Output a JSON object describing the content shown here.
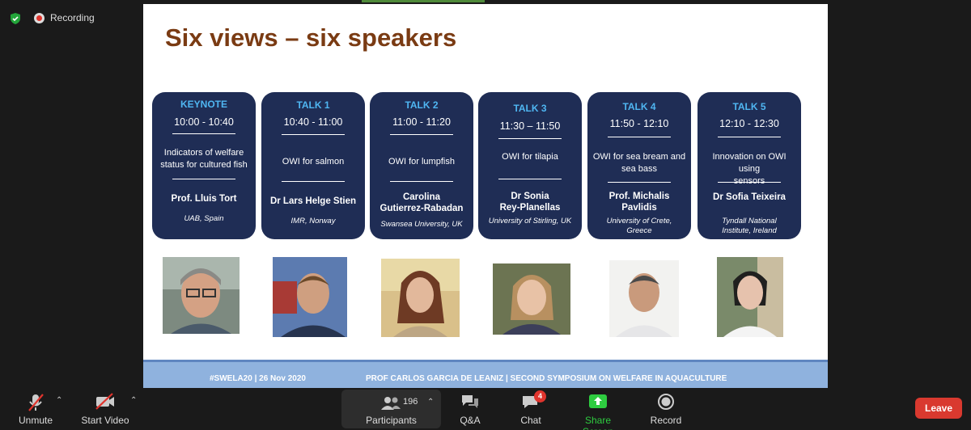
{
  "status": {
    "recording_label": "Recording"
  },
  "slide": {
    "title": "Six views – six speakers",
    "talks": [
      {
        "head": "KEYNOTE",
        "time": "10:00 - 10:40",
        "topic": [
          "Indicators of welfare",
          "status for cultured fish"
        ],
        "speaker": [
          "Prof. Lluis Tort"
        ],
        "affil": [
          "UAB, Spain"
        ]
      },
      {
        "head": "TALK 1",
        "time": "10:40 - 11:00",
        "topic": [
          "OWI for salmon"
        ],
        "speaker": [
          "Dr Lars Helge Stien"
        ],
        "affil": [
          "IMR, Norway"
        ]
      },
      {
        "head": "TALK 2",
        "time": "11:00 - 11:20",
        "topic": [
          "OWI for lumpfish"
        ],
        "speaker": [
          "Carolina",
          "Gutierrez-Rabadan"
        ],
        "affil": [
          "Swansea University, UK"
        ]
      },
      {
        "head": "TALK 3",
        "time": "11:30 – 11:50",
        "topic": [
          "OWI for tilapia"
        ],
        "speaker": [
          "Dr Sonia",
          "Rey-Planellas"
        ],
        "affil": [
          "University of Stirling, UK"
        ]
      },
      {
        "head": "TALK 4",
        "time": "11:50 - 12:10",
        "topic": [
          "OWI for sea bream and",
          "sea bass"
        ],
        "speaker": [
          "Prof. Michalis",
          "Pavlidis"
        ],
        "affil": [
          "University of Crete,",
          "Greece"
        ]
      },
      {
        "head": "TALK 5",
        "time": "12:10 - 12:30",
        "topic": [
          "Innovation on OWI using",
          "sensors"
        ],
        "speaker": [
          "Dr Sofia Teixeira"
        ],
        "affil": [
          "Tyndall National",
          "Institute, Ireland"
        ]
      }
    ],
    "footer_left": "#SWELA20 | 26 Nov 2020",
    "footer_right": "PROF CARLOS GARCIA DE LEANIZ | SECOND SYMPOSIUM ON WELFARE IN AQUACULTURE"
  },
  "toolbar": {
    "unmute": "Unmute",
    "start_video": "Start Video",
    "participants_count": "196",
    "participants": "Participants",
    "qa": "Q&A",
    "chat": "Chat",
    "chat_badge": "4",
    "share_screen": "Share Screen",
    "record": "Record",
    "leave": "Leave"
  },
  "colors": {
    "card_bg": "#1f2d55",
    "card_head": "#4fb6f2",
    "title": "#7a3b13",
    "footer_band": "#8fb2de",
    "share_green": "#2ecc40",
    "leave_red": "#d9392f"
  }
}
